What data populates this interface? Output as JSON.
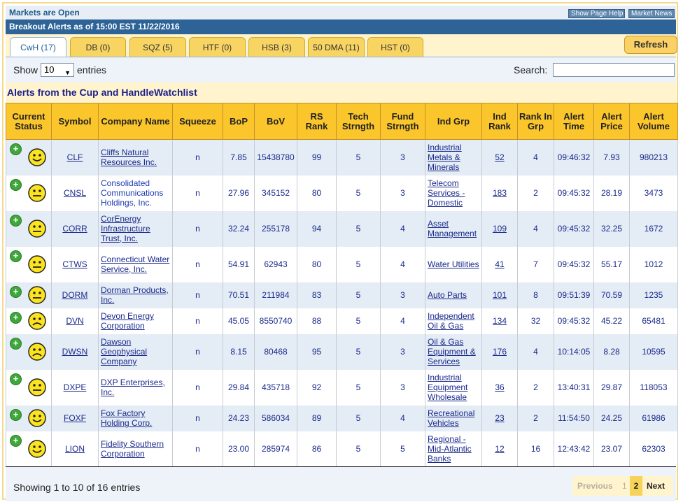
{
  "header": {
    "market_status": "Markets are Open",
    "show_help": "Show Page Help",
    "market_news": "Market News",
    "alert_title": "Breakout Alerts as of 15:00 EST 11/22/2016"
  },
  "tabs": [
    {
      "label": "CwH (17)",
      "active": true
    },
    {
      "label": "DB (0)",
      "active": false
    },
    {
      "label": "SQZ (5)",
      "active": false
    },
    {
      "label": "HTF (0)",
      "active": false
    },
    {
      "label": "HSB (3)",
      "active": false
    },
    {
      "label": "50 DMA (11)",
      "active": false
    },
    {
      "label": "HST (0)",
      "active": false
    }
  ],
  "refresh_label": "Refresh",
  "controls": {
    "show_label": "Show",
    "page_size": "10",
    "entries_label": "entries",
    "search_label": "Search:",
    "search_value": ""
  },
  "list_title": "Alerts from the Cup and HandleWatchlist",
  "columns": [
    "Current Status",
    "Symbol",
    "Company Name",
    "Squeeze",
    "BoP",
    "BoV",
    "RS Rank",
    "Tech Strngth",
    "Fund Strngth",
    "Ind Grp",
    "Ind Rank",
    "Rank In Grp",
    "Alert Time",
    "Alert Price",
    "Alert Volume"
  ],
  "rows": [
    {
      "mood": "happy",
      "symbol": "CLF",
      "company": "Cliffs Natural Resources Inc.",
      "squeeze": "n",
      "bop": "7.85",
      "bov": "15438780",
      "rs": "99",
      "tech": "5",
      "fund": "3",
      "grp": "Industrial Metals & Minerals",
      "ind_rank": "52",
      "rank_in_grp": "4",
      "time": "09:46:32",
      "price": "7.93",
      "volume": "980213"
    },
    {
      "mood": "neutral",
      "symbol": "CNSL",
      "company": "Consolidated Communications Holdings, Inc.",
      "squeeze": "n",
      "bop": "27.96",
      "bov": "345152",
      "rs": "80",
      "tech": "5",
      "fund": "3",
      "grp": "Telecom Services - Domestic",
      "ind_rank": "183",
      "rank_in_grp": "2",
      "time": "09:45:32",
      "price": "28.19",
      "volume": "3473"
    },
    {
      "mood": "neutral",
      "symbol": "CORR",
      "company": "CorEnergy Infrastructure Trust, Inc.",
      "squeeze": "n",
      "bop": "32.24",
      "bov": "255178",
      "rs": "94",
      "tech": "5",
      "fund": "4",
      "grp": "Asset Management",
      "ind_rank": "109",
      "rank_in_grp": "4",
      "time": "09:45:32",
      "price": "32.25",
      "volume": "1672"
    },
    {
      "mood": "neutral",
      "symbol": "CTWS",
      "company": "Connecticut Water Service, Inc.",
      "squeeze": "n",
      "bop": "54.91",
      "bov": "62943",
      "rs": "80",
      "tech": "5",
      "fund": "4",
      "grp": "Water Utilities",
      "ind_rank": "41",
      "rank_in_grp": "7",
      "time": "09:45:32",
      "price": "55.17",
      "volume": "1012"
    },
    {
      "mood": "neutral",
      "symbol": "DORM",
      "company": "Dorman Products, Inc.",
      "squeeze": "n",
      "bop": "70.51",
      "bov": "211984",
      "rs": "83",
      "tech": "5",
      "fund": "3",
      "grp": "Auto Parts",
      "ind_rank": "101",
      "rank_in_grp": "8",
      "time": "09:51:39",
      "price": "70.59",
      "volume": "1235"
    },
    {
      "mood": "sad",
      "symbol": "DVN",
      "company": "Devon Energy Corporation",
      "squeeze": "n",
      "bop": "45.05",
      "bov": "8550740",
      "rs": "88",
      "tech": "5",
      "fund": "4",
      "grp": "Independent Oil & Gas",
      "ind_rank": "134",
      "rank_in_grp": "32",
      "time": "09:45:32",
      "price": "45.22",
      "volume": "65481"
    },
    {
      "mood": "sad",
      "symbol": "DWSN",
      "company": "Dawson Geophysical Company",
      "squeeze": "n",
      "bop": "8.15",
      "bov": "80468",
      "rs": "95",
      "tech": "5",
      "fund": "3",
      "grp": "Oil & Gas Equipment & Services",
      "ind_rank": "176",
      "rank_in_grp": "4",
      "time": "10:14:05",
      "price": "8.28",
      "volume": "10595"
    },
    {
      "mood": "neutral",
      "symbol": "DXPE",
      "company": "DXP Enterprises, Inc.",
      "squeeze": "n",
      "bop": "29.84",
      "bov": "435718",
      "rs": "92",
      "tech": "5",
      "fund": "3",
      "grp": "Industrial Equipment Wholesale",
      "ind_rank": "36",
      "rank_in_grp": "2",
      "time": "13:40:31",
      "price": "29.87",
      "volume": "118053"
    },
    {
      "mood": "happy",
      "symbol": "FOXF",
      "company": "Fox Factory Holding Corp.",
      "squeeze": "n",
      "bop": "24.23",
      "bov": "586034",
      "rs": "89",
      "tech": "5",
      "fund": "4",
      "grp": "Recreational Vehicles",
      "ind_rank": "23",
      "rank_in_grp": "2",
      "time": "11:54:50",
      "price": "24.25",
      "volume": "61986"
    },
    {
      "mood": "happy",
      "symbol": "LION",
      "company": "Fidelity Southern Corporation",
      "squeeze": "n",
      "bop": "23.00",
      "bov": "285974",
      "rs": "86",
      "tech": "5",
      "fund": "5",
      "grp": "Regional - Mid-Atlantic Banks",
      "ind_rank": "12",
      "rank_in_grp": "16",
      "time": "12:43:42",
      "price": "23.07",
      "volume": "62303"
    }
  ],
  "row_heights": [],
  "footer": {
    "showing": "Showing 1 to 10 of 16 entries",
    "prev": "Previous",
    "page1": "1",
    "page2": "2",
    "next": "Next"
  },
  "colors": {
    "accent": "#2d6396",
    "header_gold": "#fbc62b",
    "tab_gold": "#f8d463",
    "row_alt": "#e4ecf5",
    "link": "#1a2a8b"
  }
}
